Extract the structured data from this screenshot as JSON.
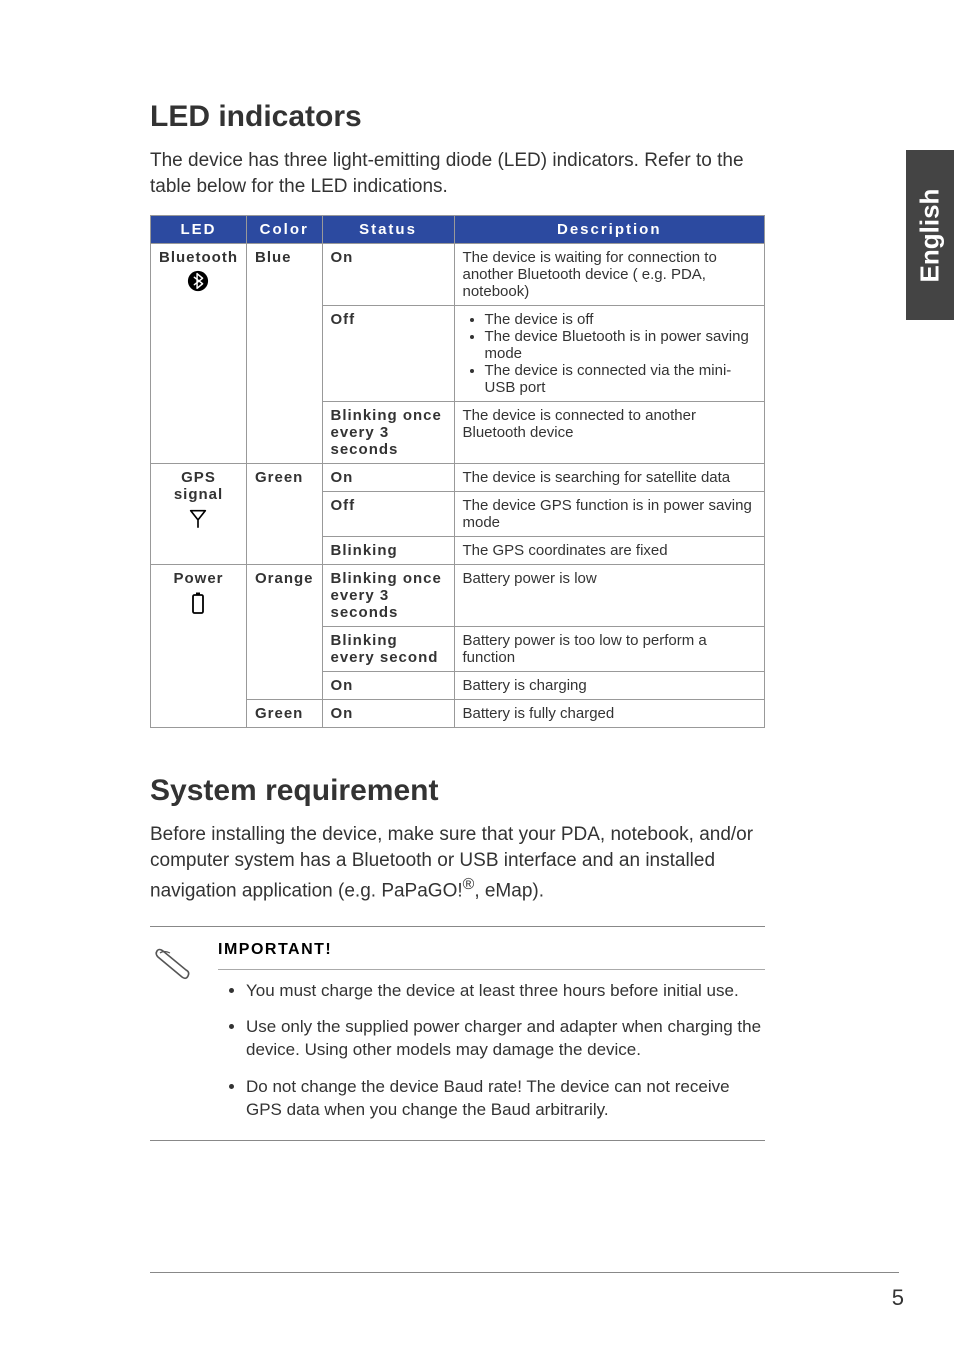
{
  "sideTab": {
    "label": "English"
  },
  "section1": {
    "heading": "LED indicators",
    "intro": "The device has three light-emitting diode (LED) indicators. Refer to the table below for the LED indications."
  },
  "table": {
    "headers": {
      "led": "LED",
      "color": "Color",
      "status": "Status",
      "description": "Description"
    }
  },
  "leds": {
    "bluetooth": {
      "name": "Bluetooth",
      "iconName": "bluetooth-icon",
      "color": "Blue",
      "rows": [
        {
          "status": "On",
          "description": "The device is waiting for connection to another Bluetooth device ( e.g. PDA, notebook)"
        },
        {
          "status": "Off",
          "descriptionList": [
            "The device is off",
            "The device Bluetooth is in power saving mode",
            "The device is connected via the mini-USB port"
          ]
        },
        {
          "status": "Blinking once every 3 seconds",
          "description": "The device is connected to another Bluetooth device"
        }
      ]
    },
    "gps": {
      "name": "GPS signal",
      "iconName": "antenna-icon",
      "color": "Green",
      "rows": [
        {
          "status": "On",
          "description": "The device is searching for satellite data"
        },
        {
          "status": "Off",
          "description": "The device GPS function is in power saving mode"
        },
        {
          "status": "Blinking",
          "description": "The GPS coordinates are fixed"
        }
      ]
    },
    "power": {
      "name": "Power",
      "iconName": "battery-icon",
      "colors": {
        "orange": {
          "label": "Orange",
          "rows": [
            {
              "status": "Blinking once every 3 seconds",
              "description": "Battery power is low"
            },
            {
              "status": "Blinking every second",
              "description": "Battery power is too low to perform a function"
            },
            {
              "status": "On",
              "description": "Battery is charging"
            }
          ]
        },
        "green": {
          "label": "Green",
          "rows": [
            {
              "status": "On",
              "description": "Battery is fully charged"
            }
          ]
        }
      }
    }
  },
  "section2": {
    "heading": "System requirement",
    "introPrefix": "Before installing the device, make sure that your PDA, notebook, and/or computer system has a Bluetooth or USB interface and an installed navigation application (e.g. PaPaGO!",
    "introSuffix": ", eMap).",
    "trademark": "®"
  },
  "noteBlock": {
    "heading": "IMPORTANT!",
    "items": [
      "You must charge the device at least three hours before initial use.",
      "Use only the supplied power charger and adapter when charging the device. Using other models may damage the device.",
      "Do not change the device Baud rate! The device can not receive GPS data when you change the Baud arbitrarily."
    ]
  },
  "pageNumber": "5"
}
